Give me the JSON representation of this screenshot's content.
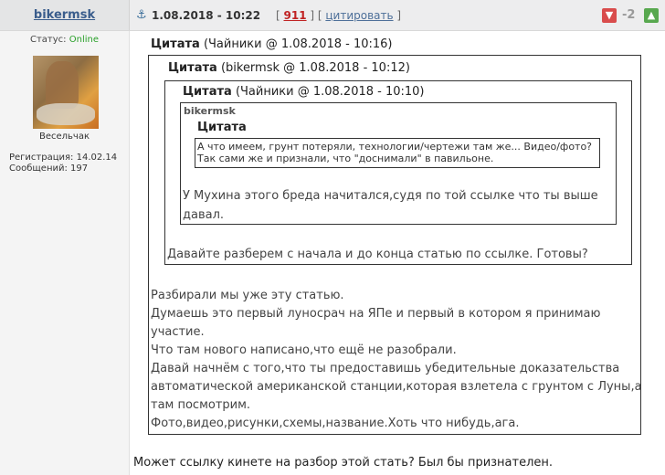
{
  "post": {
    "author": "bikermsk",
    "date": "1.08.2018 - 10:22",
    "number": "911",
    "quote_link": "цитировать",
    "score": "-2"
  },
  "user": {
    "status_label": "Статус:",
    "status_value": "Online",
    "rank": "Весельчак",
    "registration": "Регистрация: 14.02.14",
    "messages": "Сообщений: 197"
  },
  "quotes": {
    "q1_label": "Цитата",
    "q1_meta": "(Чайники @ 1.08.2018 - 10:16)",
    "q2_label": "Цитата",
    "q2_meta": "(bikermsk @ 1.08.2018 - 10:12)",
    "q3_label": "Цитата",
    "q3_meta": "(Чайники @ 1.08.2018 - 10:10)",
    "q4_author": "bikermsk",
    "q4_label": "Цитата",
    "q4_line1": "А что имеем, грунт потеряли, технологии/чертежи там же... Видео/фото?",
    "q4_line2": "Так сами же и признали, что \"доснимали\" в павильоне.",
    "q3_text1": "У Мухина этого бреда начитался,судя по той ссылке что ты выше",
    "q3_text2": "давал.",
    "q2_text": "Давайте разберем с начала и до конца статью по ссылке. Готовы?",
    "q1_lines": [
      "Разбирали мы уже эту статью.",
      "Думаешь это первый луносрач на ЯПе и первый в котором я принимаю",
      "участие.",
      "Что там нового написано,что ещё не разобрали.",
      "Давай начнём с того,что ты предоставишь убедительные доказательства",
      "автоматической американской станции,которая взлетела с грунтом с Луны,а",
      "там посмотрим.",
      "Фото,видео,рисунки,схемы,название.Хоть что нибудь,ага."
    ]
  },
  "reply": "Может ссылку кинете на разбор этой стать? Был бы признателен.",
  "icons": {
    "anchor": "anchor-icon",
    "vote_down": "thumbs-down-icon",
    "vote_up": "thumbs-up-icon"
  },
  "colors": {
    "online": "#2aa02a",
    "post_number": "#c02222",
    "vote_down": "#d94c4c",
    "vote_up": "#58a84f"
  }
}
